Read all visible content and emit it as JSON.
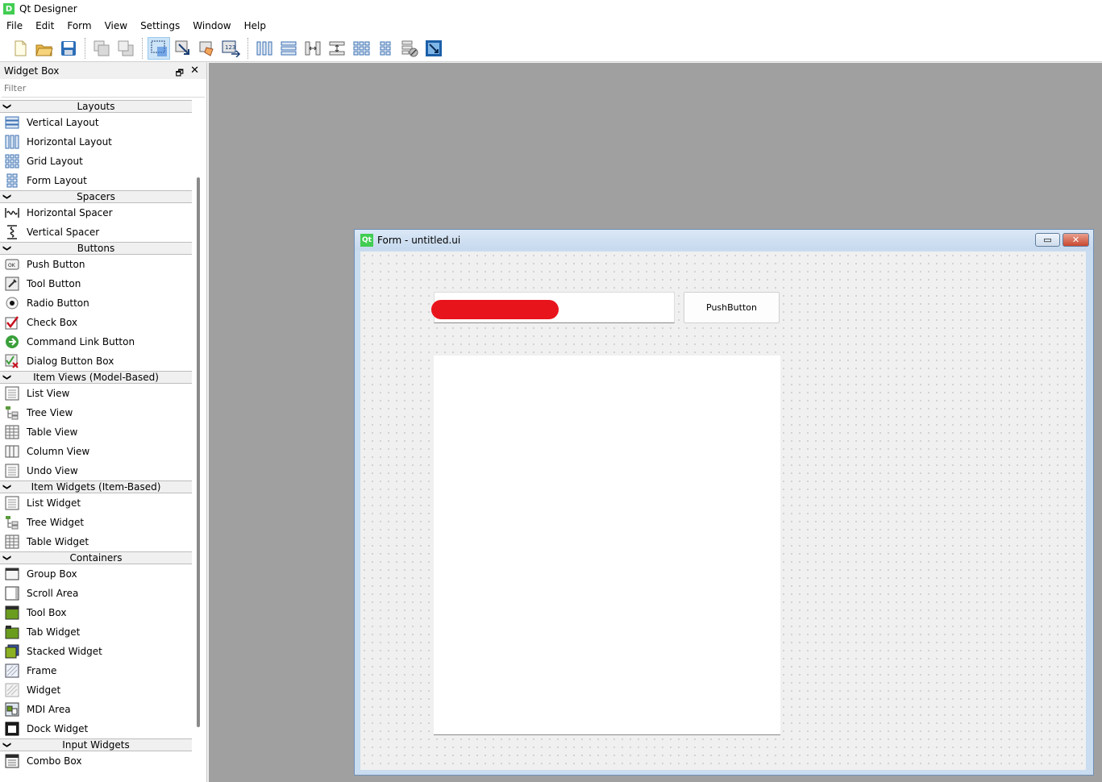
{
  "app": {
    "title": "Qt Designer",
    "icon_letter": "D"
  },
  "menu": [
    "File",
    "Edit",
    "Form",
    "View",
    "Settings",
    "Window",
    "Help"
  ],
  "toolbar": {
    "buttons": [
      {
        "name": "new-form-icon"
      },
      {
        "name": "open-form-icon"
      },
      {
        "name": "save-form-icon"
      },
      {
        "name": "send-to-back-icon"
      },
      {
        "name": "bring-to-front-icon"
      },
      {
        "name": "edit-widgets-icon",
        "active": true
      },
      {
        "name": "edit-signals-slots-icon"
      },
      {
        "name": "edit-buddies-icon"
      },
      {
        "name": "edit-tab-order-icon"
      },
      {
        "name": "lay-out-horizontally-icon"
      },
      {
        "name": "lay-out-vertically-icon"
      },
      {
        "name": "lay-out-horizontal-splitter-icon"
      },
      {
        "name": "lay-out-vertical-splitter-icon"
      },
      {
        "name": "lay-out-grid-icon"
      },
      {
        "name": "lay-out-form-icon"
      },
      {
        "name": "break-layout-icon"
      },
      {
        "name": "adjust-size-icon"
      }
    ]
  },
  "widget_box": {
    "title": "Widget Box",
    "filter_placeholder": "Filter",
    "categories": [
      {
        "label": "Layouts",
        "items": [
          "Vertical Layout",
          "Horizontal Layout",
          "Grid Layout",
          "Form Layout"
        ]
      },
      {
        "label": "Spacers",
        "items": [
          "Horizontal Spacer",
          "Vertical Spacer"
        ]
      },
      {
        "label": "Buttons",
        "items": [
          "Push Button",
          "Tool Button",
          "Radio Button",
          "Check Box",
          "Command Link Button",
          "Dialog Button Box"
        ]
      },
      {
        "label": "Item Views (Model-Based)",
        "items": [
          "List View",
          "Tree View",
          "Table View",
          "Column View",
          "Undo View"
        ]
      },
      {
        "label": "Item Widgets (Item-Based)",
        "items": [
          "List Widget",
          "Tree Widget",
          "Table Widget"
        ]
      },
      {
        "label": "Containers",
        "items": [
          "Group Box",
          "Scroll Area",
          "Tool Box",
          "Tab Widget",
          "Stacked Widget",
          "Frame",
          "Widget",
          "MDI Area",
          "Dock Widget"
        ]
      },
      {
        "label": "Input Widgets",
        "items": [
          "Combo Box"
        ]
      }
    ]
  },
  "form": {
    "title": "Form - untitled.ui",
    "icon_label": "Qt",
    "push_button_label": "PushButton",
    "close_glyph": "✕",
    "minimize_glyph": "▭"
  },
  "colors": {
    "accent": "#cce4f7",
    "redaction": "#e8141c",
    "mdi_background": "#a0a0a0",
    "qt_green": "#41cd52"
  }
}
